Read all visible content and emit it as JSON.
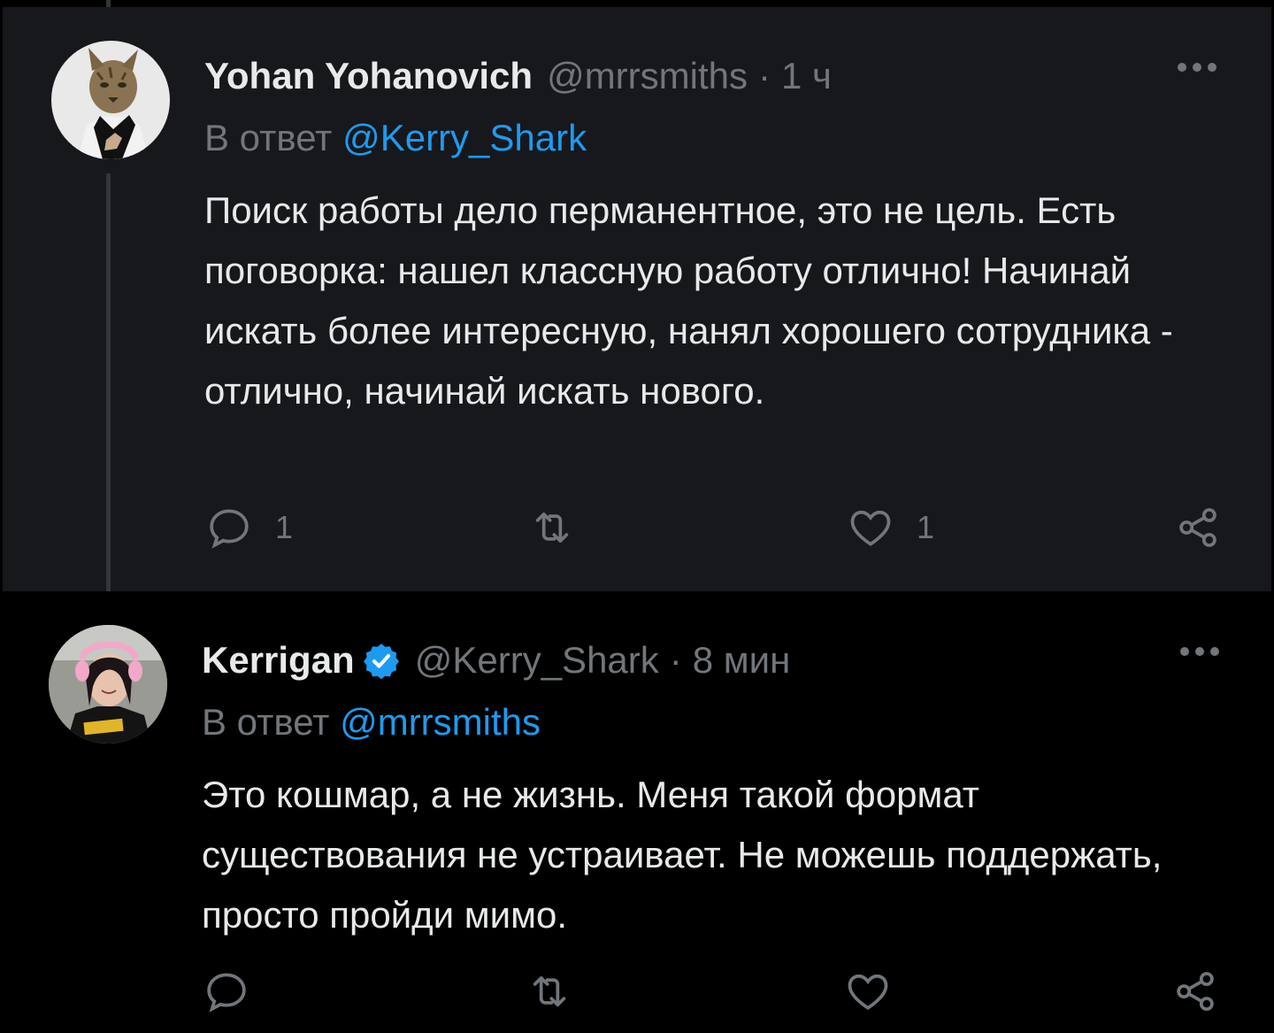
{
  "tweets": [
    {
      "display_name": "Yohan Yohanovich",
      "handle": "@mrrsmiths",
      "separator": "·",
      "time": "1 ч",
      "reply_prefix": "В ответ",
      "reply_mention": "@Kerry_Shark",
      "text": "Поиск работы дело перманентное, это не цель. Есть поговорка: нашел классную работу отлично! Начинай искать более интересную, нанял хорошего сотрудника - отлично, начинай искать нового.",
      "reply_count": "1",
      "retweet_count": "",
      "like_count": "1",
      "verified": false
    },
    {
      "display_name": "Kerrigan",
      "handle": "@Kerry_Shark",
      "separator": "·",
      "time": "8 мин",
      "reply_prefix": "В ответ",
      "reply_mention": "@mrrsmiths",
      "text": "Это кошмар, а не жизнь. Меня такой формат существования не устраивает. Не можешь поддержать, просто пройди мимо.",
      "reply_count": "",
      "retweet_count": "",
      "like_count": "",
      "verified": true
    }
  ],
  "colors": {
    "background": "#000000",
    "highlighted_background": "#16181c",
    "primary_text": "#e7e9ea",
    "secondary_text": "#71767b",
    "accent": "#1d9bf0",
    "thread_line": "#333639"
  },
  "icons": {
    "reply": "reply-icon",
    "retweet": "retweet-icon",
    "like": "like-icon",
    "share": "share-icon",
    "more": "more-icon",
    "verified": "verified-badge-icon"
  }
}
